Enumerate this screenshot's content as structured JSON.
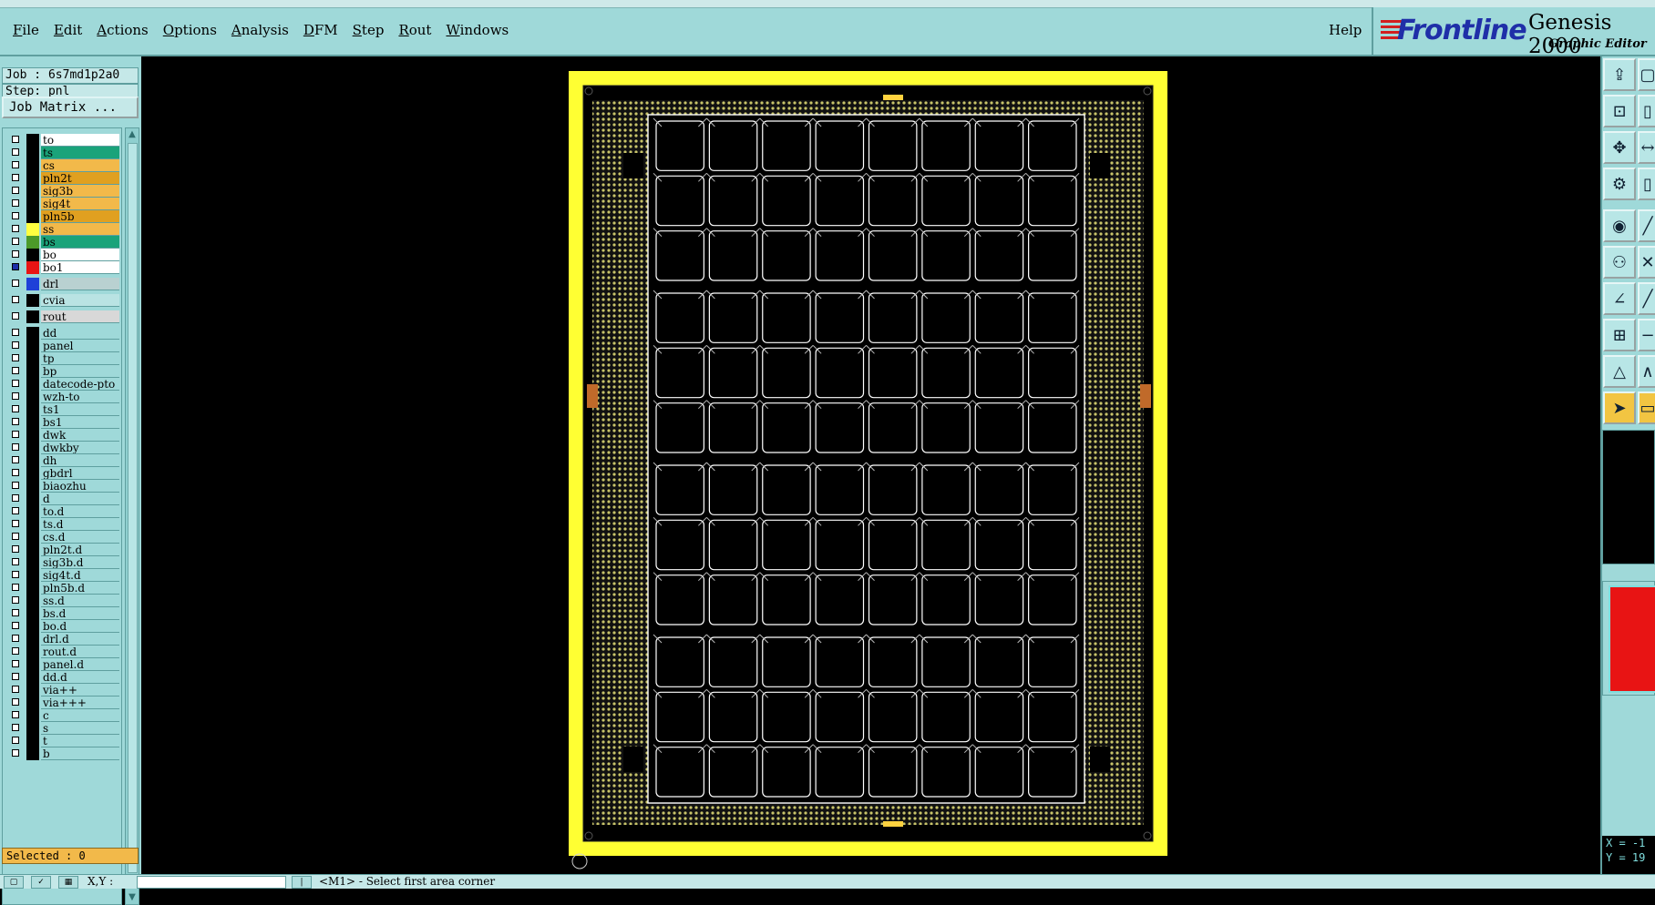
{
  "menubar": {
    "items": [
      "File",
      "Edit",
      "Actions",
      "Options",
      "Analysis",
      "DFM",
      "Step",
      "Rout",
      "Windows"
    ],
    "help": "Help",
    "logo": {
      "brand": "Frontline",
      "product": "Genesis 2000",
      "subtitle": "Graphic Editor"
    }
  },
  "job": {
    "job_label": "Job : 6s7md1p2a0",
    "step_label": "Step: pnl",
    "matrix_button": "Job Matrix ..."
  },
  "layers": [
    {
      "name": "to",
      "color": "#ffffff"
    },
    {
      "name": "ts",
      "color": "#1aa37a"
    },
    {
      "name": "cs",
      "color": "#f2b94a"
    },
    {
      "name": "pln2t",
      "color": "#e0a020"
    },
    {
      "name": "sig3b",
      "color": "#f2b94a"
    },
    {
      "name": "sig4t",
      "color": "#f2b94a"
    },
    {
      "name": "pln5b",
      "color": "#e0a020"
    },
    {
      "name": "ss",
      "color": "#f2b94a",
      "swatch": "#ffff40"
    },
    {
      "name": "bs",
      "color": "#1aa37a",
      "swatch": "#4c9a2a"
    },
    {
      "name": "bo",
      "color": "#ffffff"
    },
    {
      "name": "bo1",
      "color": "#ffffff",
      "swatch": "#e81414",
      "checked": true
    },
    {
      "name": "drl",
      "color": "#b9d1d1",
      "swatch": "#1e40d8"
    },
    {
      "name": "cvia",
      "color": "#b9e3e3"
    },
    {
      "name": "rout",
      "color": "#d8d8d8"
    },
    {
      "name": "dd",
      "color": "#9fd9d9"
    },
    {
      "name": "panel",
      "color": "#9fd9d9"
    },
    {
      "name": "tp",
      "color": "#9fd9d9"
    },
    {
      "name": "bp",
      "color": "#9fd9d9"
    },
    {
      "name": "datecode-pto",
      "color": "#9fd9d9"
    },
    {
      "name": "wzh-to",
      "color": "#9fd9d9"
    },
    {
      "name": "ts1",
      "color": "#9fd9d9"
    },
    {
      "name": "bs1",
      "color": "#9fd9d9"
    },
    {
      "name": "dwk",
      "color": "#9fd9d9"
    },
    {
      "name": "dwkby",
      "color": "#9fd9d9"
    },
    {
      "name": "dh",
      "color": "#9fd9d9"
    },
    {
      "name": "gbdrl",
      "color": "#9fd9d9"
    },
    {
      "name": "biaozhu",
      "color": "#9fd9d9"
    },
    {
      "name": "d",
      "color": "#9fd9d9"
    },
    {
      "name": "to.d",
      "color": "#9fd9d9"
    },
    {
      "name": "ts.d",
      "color": "#9fd9d9"
    },
    {
      "name": "cs.d",
      "color": "#9fd9d9"
    },
    {
      "name": "pln2t.d",
      "color": "#9fd9d9"
    },
    {
      "name": "sig3b.d",
      "color": "#9fd9d9"
    },
    {
      "name": "sig4t.d",
      "color": "#9fd9d9"
    },
    {
      "name": "pln5b.d",
      "color": "#9fd9d9"
    },
    {
      "name": "ss.d",
      "color": "#9fd9d9"
    },
    {
      "name": "bs.d",
      "color": "#9fd9d9"
    },
    {
      "name": "bo.d",
      "color": "#9fd9d9"
    },
    {
      "name": "drl.d",
      "color": "#9fd9d9"
    },
    {
      "name": "rout.d",
      "color": "#9fd9d9"
    },
    {
      "name": "panel.d",
      "color": "#9fd9d9"
    },
    {
      "name": "dd.d",
      "color": "#9fd9d9"
    },
    {
      "name": "via++",
      "color": "#9fd9d9"
    },
    {
      "name": "via+++",
      "color": "#9fd9d9"
    },
    {
      "name": "c",
      "color": "#9fd9d9"
    },
    {
      "name": "s",
      "color": "#9fd9d9"
    },
    {
      "name": "t",
      "color": "#9fd9d9"
    },
    {
      "name": "b",
      "color": "#9fd9d9"
    }
  ],
  "selected": "Selected : 0",
  "status": {
    "xy_label": "X,Y :",
    "message": "<M1> - Select first area corner"
  },
  "coords": {
    "x": "X = -1",
    "y": "Y = 19"
  },
  "colors": {
    "ui_bg": "#9fd9d9",
    "panel_frame": "#ffff33",
    "board_outline": "#ffffff",
    "active_layer": "#e81414"
  },
  "board": {
    "rows": 12,
    "cols": 8
  }
}
